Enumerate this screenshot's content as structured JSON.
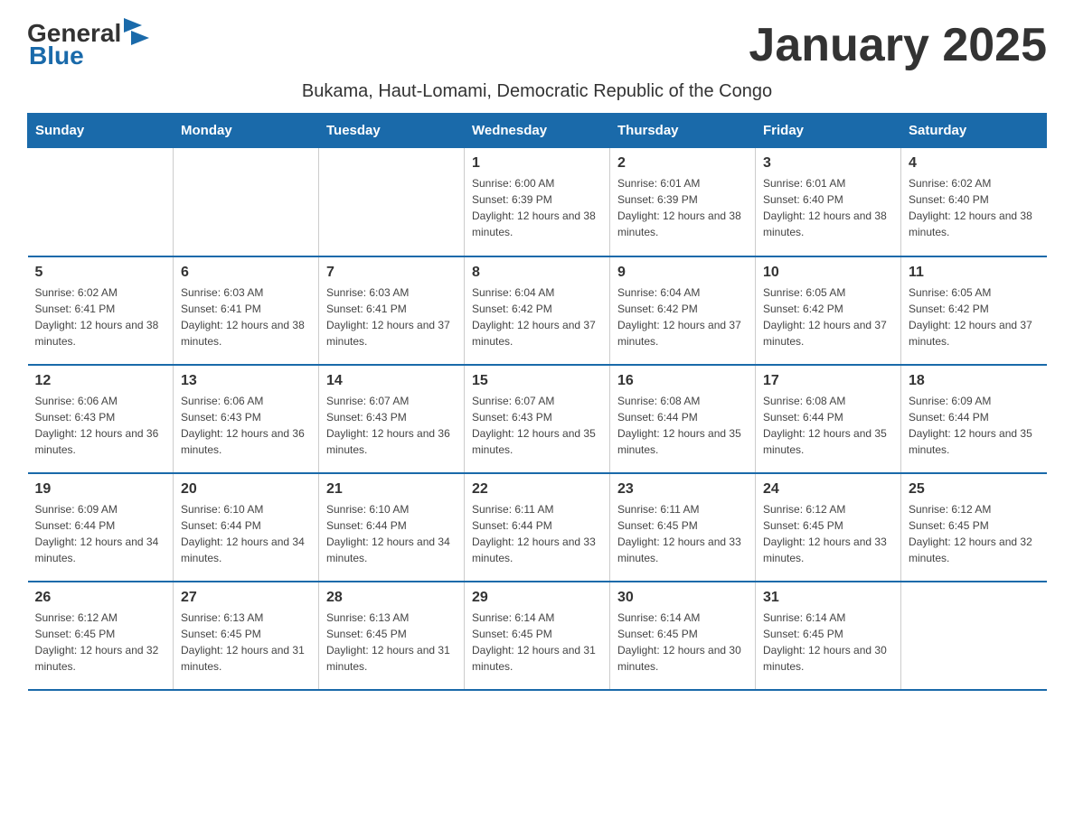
{
  "logo": {
    "text_general": "General",
    "text_blue": "Blue"
  },
  "title": "January 2025",
  "subtitle": "Bukama, Haut-Lomami, Democratic Republic of the Congo",
  "days_of_week": [
    "Sunday",
    "Monday",
    "Tuesday",
    "Wednesday",
    "Thursday",
    "Friday",
    "Saturday"
  ],
  "weeks": [
    [
      {
        "day": "",
        "info": ""
      },
      {
        "day": "",
        "info": ""
      },
      {
        "day": "",
        "info": ""
      },
      {
        "day": "1",
        "info": "Sunrise: 6:00 AM\nSunset: 6:39 PM\nDaylight: 12 hours and 38 minutes."
      },
      {
        "day": "2",
        "info": "Sunrise: 6:01 AM\nSunset: 6:39 PM\nDaylight: 12 hours and 38 minutes."
      },
      {
        "day": "3",
        "info": "Sunrise: 6:01 AM\nSunset: 6:40 PM\nDaylight: 12 hours and 38 minutes."
      },
      {
        "day": "4",
        "info": "Sunrise: 6:02 AM\nSunset: 6:40 PM\nDaylight: 12 hours and 38 minutes."
      }
    ],
    [
      {
        "day": "5",
        "info": "Sunrise: 6:02 AM\nSunset: 6:41 PM\nDaylight: 12 hours and 38 minutes."
      },
      {
        "day": "6",
        "info": "Sunrise: 6:03 AM\nSunset: 6:41 PM\nDaylight: 12 hours and 38 minutes."
      },
      {
        "day": "7",
        "info": "Sunrise: 6:03 AM\nSunset: 6:41 PM\nDaylight: 12 hours and 37 minutes."
      },
      {
        "day": "8",
        "info": "Sunrise: 6:04 AM\nSunset: 6:42 PM\nDaylight: 12 hours and 37 minutes."
      },
      {
        "day": "9",
        "info": "Sunrise: 6:04 AM\nSunset: 6:42 PM\nDaylight: 12 hours and 37 minutes."
      },
      {
        "day": "10",
        "info": "Sunrise: 6:05 AM\nSunset: 6:42 PM\nDaylight: 12 hours and 37 minutes."
      },
      {
        "day": "11",
        "info": "Sunrise: 6:05 AM\nSunset: 6:42 PM\nDaylight: 12 hours and 37 minutes."
      }
    ],
    [
      {
        "day": "12",
        "info": "Sunrise: 6:06 AM\nSunset: 6:43 PM\nDaylight: 12 hours and 36 minutes."
      },
      {
        "day": "13",
        "info": "Sunrise: 6:06 AM\nSunset: 6:43 PM\nDaylight: 12 hours and 36 minutes."
      },
      {
        "day": "14",
        "info": "Sunrise: 6:07 AM\nSunset: 6:43 PM\nDaylight: 12 hours and 36 minutes."
      },
      {
        "day": "15",
        "info": "Sunrise: 6:07 AM\nSunset: 6:43 PM\nDaylight: 12 hours and 35 minutes."
      },
      {
        "day": "16",
        "info": "Sunrise: 6:08 AM\nSunset: 6:44 PM\nDaylight: 12 hours and 35 minutes."
      },
      {
        "day": "17",
        "info": "Sunrise: 6:08 AM\nSunset: 6:44 PM\nDaylight: 12 hours and 35 minutes."
      },
      {
        "day": "18",
        "info": "Sunrise: 6:09 AM\nSunset: 6:44 PM\nDaylight: 12 hours and 35 minutes."
      }
    ],
    [
      {
        "day": "19",
        "info": "Sunrise: 6:09 AM\nSunset: 6:44 PM\nDaylight: 12 hours and 34 minutes."
      },
      {
        "day": "20",
        "info": "Sunrise: 6:10 AM\nSunset: 6:44 PM\nDaylight: 12 hours and 34 minutes."
      },
      {
        "day": "21",
        "info": "Sunrise: 6:10 AM\nSunset: 6:44 PM\nDaylight: 12 hours and 34 minutes."
      },
      {
        "day": "22",
        "info": "Sunrise: 6:11 AM\nSunset: 6:44 PM\nDaylight: 12 hours and 33 minutes."
      },
      {
        "day": "23",
        "info": "Sunrise: 6:11 AM\nSunset: 6:45 PM\nDaylight: 12 hours and 33 minutes."
      },
      {
        "day": "24",
        "info": "Sunrise: 6:12 AM\nSunset: 6:45 PM\nDaylight: 12 hours and 33 minutes."
      },
      {
        "day": "25",
        "info": "Sunrise: 6:12 AM\nSunset: 6:45 PM\nDaylight: 12 hours and 32 minutes."
      }
    ],
    [
      {
        "day": "26",
        "info": "Sunrise: 6:12 AM\nSunset: 6:45 PM\nDaylight: 12 hours and 32 minutes."
      },
      {
        "day": "27",
        "info": "Sunrise: 6:13 AM\nSunset: 6:45 PM\nDaylight: 12 hours and 31 minutes."
      },
      {
        "day": "28",
        "info": "Sunrise: 6:13 AM\nSunset: 6:45 PM\nDaylight: 12 hours and 31 minutes."
      },
      {
        "day": "29",
        "info": "Sunrise: 6:14 AM\nSunset: 6:45 PM\nDaylight: 12 hours and 31 minutes."
      },
      {
        "day": "30",
        "info": "Sunrise: 6:14 AM\nSunset: 6:45 PM\nDaylight: 12 hours and 30 minutes."
      },
      {
        "day": "31",
        "info": "Sunrise: 6:14 AM\nSunset: 6:45 PM\nDaylight: 12 hours and 30 minutes."
      },
      {
        "day": "",
        "info": ""
      }
    ]
  ]
}
